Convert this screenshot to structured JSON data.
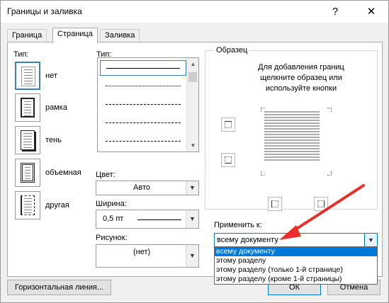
{
  "window": {
    "title": "Границы и заливка",
    "help_glyph": "?",
    "close_glyph": "✕"
  },
  "tabs": [
    {
      "label": "Граница",
      "active": false
    },
    {
      "label": "Страница",
      "active": true
    },
    {
      "label": "Заливка",
      "active": false
    }
  ],
  "settings": {
    "heading": "Тип:",
    "items": [
      {
        "label": "нет",
        "icon": "page-none-icon",
        "selected": true
      },
      {
        "label": "рамка",
        "icon": "page-box-icon",
        "selected": false
      },
      {
        "label": "тень",
        "icon": "page-shadow-icon",
        "selected": false
      },
      {
        "label": "объемная",
        "icon": "page-3d-icon",
        "selected": false
      },
      {
        "label": "другая",
        "icon": "page-custom-icon",
        "selected": false
      }
    ]
  },
  "style": {
    "heading": "Тип:",
    "line_styles": [
      "solid",
      "dotted",
      "dashed-short",
      "dashed",
      "dash-dot"
    ]
  },
  "color": {
    "label": "Цвет:",
    "value": "Авто"
  },
  "width": {
    "label": "Ширина:",
    "value": "0,5 пт"
  },
  "art": {
    "label": "Рисунок:",
    "value": "(нет)"
  },
  "preview": {
    "heading": "Образец",
    "hint": "Для добавления границ щелкните образец или используйте кнопки"
  },
  "apply_to": {
    "label": "Применить к:",
    "value": "всему документу",
    "options": [
      "всему документу",
      "этому разделу",
      "этому разделу (только 1-й странице)",
      "этому разделу (кроме 1-й страницы)"
    ],
    "selected_index": 0
  },
  "buttons": {
    "horizontal_line": "Горизонтальная линия...",
    "ok": "ОК",
    "cancel": "Отмена"
  },
  "colors": {
    "accent": "#0078d7",
    "annotation_arrow": "#e8302a",
    "selection_border": "#3c7fb1"
  }
}
